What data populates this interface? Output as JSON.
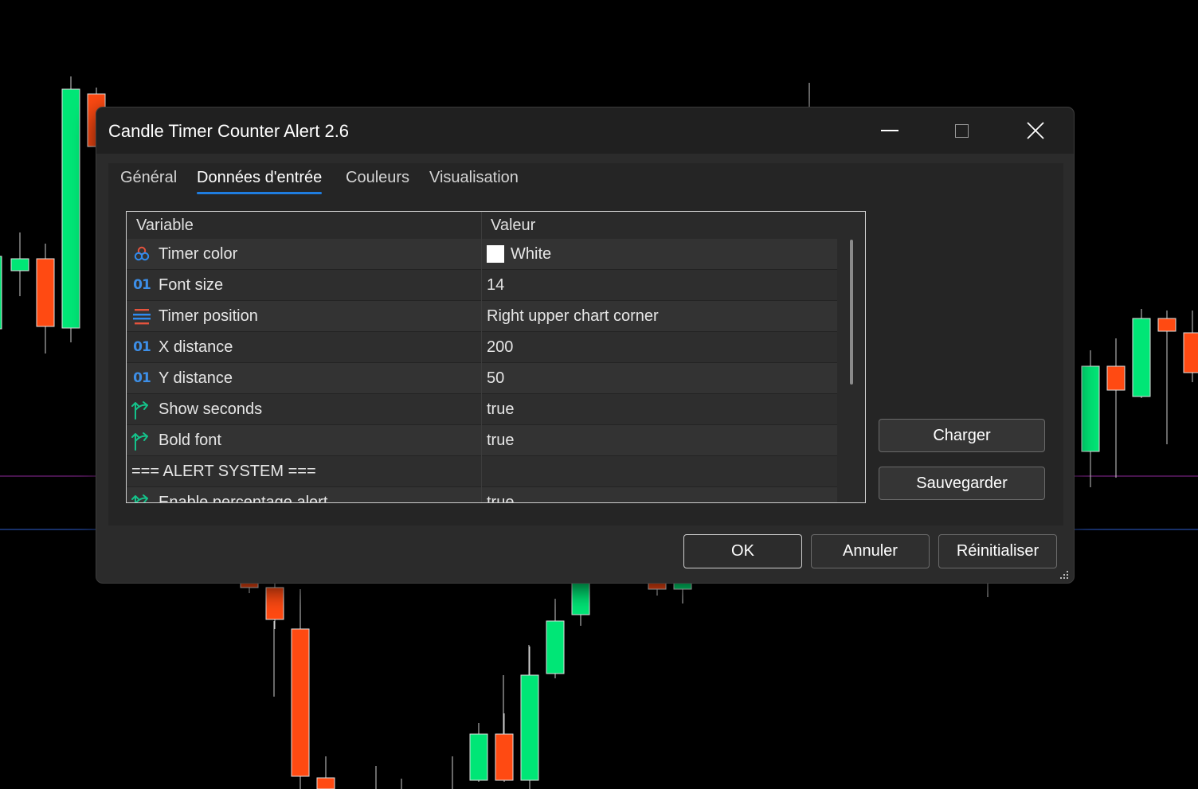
{
  "window": {
    "title": "Candle Timer Counter Alert 2.6"
  },
  "tabs": [
    {
      "label": "Général"
    },
    {
      "label": "Données d'entrée",
      "active": true
    },
    {
      "label": "Couleurs"
    },
    {
      "label": "Visualisation"
    }
  ],
  "grid": {
    "columns": {
      "variable": "Variable",
      "value": "Valeur"
    },
    "rows": [
      {
        "icon": "color-icon",
        "variable": "Timer color",
        "value": "White",
        "swatch": "#ffffff"
      },
      {
        "icon": "number-icon",
        "variable": "Font size",
        "value": "14"
      },
      {
        "icon": "list-icon",
        "variable": "Timer position",
        "value": "Right upper chart corner"
      },
      {
        "icon": "number-icon",
        "variable": "X distance",
        "value": "200"
      },
      {
        "icon": "number-icon",
        "variable": "Y distance",
        "value": "50"
      },
      {
        "icon": "boolean-icon",
        "variable": "Show seconds",
        "value": "true"
      },
      {
        "icon": "boolean-icon",
        "variable": "Bold font",
        "value": "true"
      },
      {
        "icon": "none",
        "variable": "=== ALERT SYSTEM ===",
        "value": ""
      },
      {
        "icon": "boolean-icon",
        "variable": "Enable percentage alert",
        "value": "true"
      }
    ]
  },
  "side_buttons": {
    "load": "Charger",
    "save": "Sauvegarder"
  },
  "footer_buttons": {
    "ok": "OK",
    "cancel": "Annuler",
    "reset": "Réinitialiser"
  },
  "colors": {
    "bull": "#00e676",
    "bear": "#ff4a12",
    "accent": "#1f7de0",
    "level_magenta": "#9c27b0",
    "level_blue": "#2962ff"
  }
}
